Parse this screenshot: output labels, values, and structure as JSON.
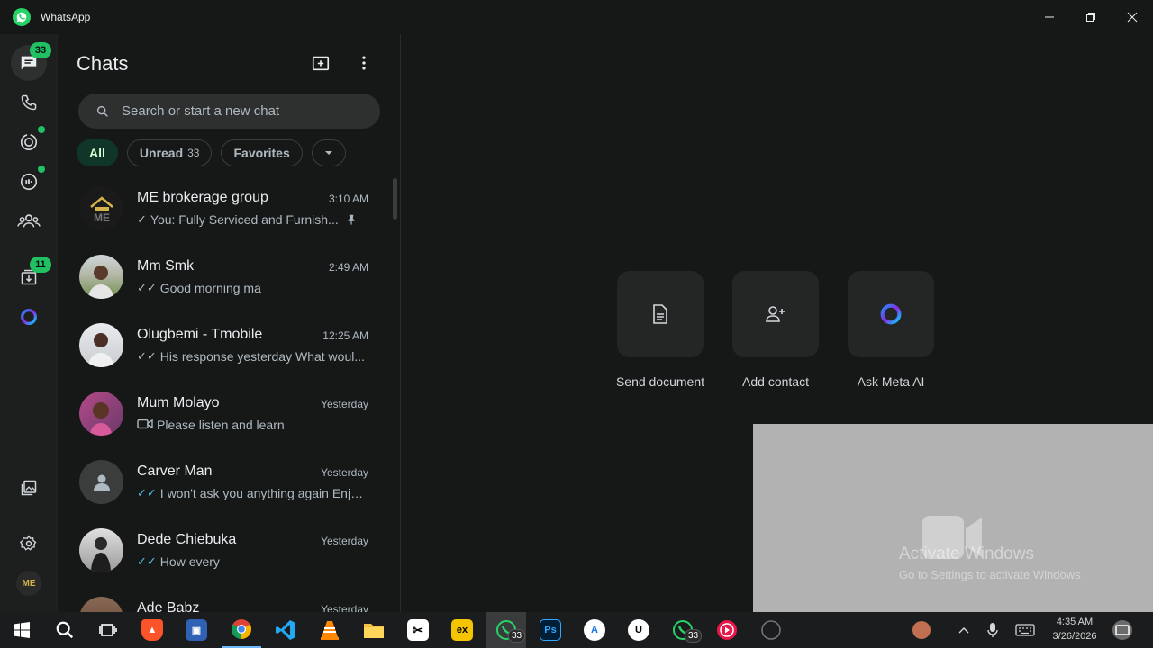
{
  "window": {
    "title": "WhatsApp"
  },
  "rail": {
    "chats_badge": "33",
    "communities_badge": "11"
  },
  "panel": {
    "title": "Chats",
    "search_placeholder": "Search or start a new chat",
    "filters": [
      {
        "label": "All"
      },
      {
        "label": "Unread",
        "count": "33"
      },
      {
        "label": "Favorites"
      }
    ]
  },
  "chats": [
    {
      "name": "ME brokerage group",
      "time": "3:10 AM",
      "tick": "✓",
      "tick_blue": false,
      "message": "You: Fully Serviced  and Furnish...",
      "pinned": true,
      "avatar_text": "ME",
      "avatar_color": "#1a1a1a"
    },
    {
      "name": "Mm Smk",
      "time": "2:49 AM",
      "tick": "✓✓",
      "tick_blue": false,
      "message": "Good morning ma",
      "avatar_text": "",
      "avatar_color": "#7e9a6a"
    },
    {
      "name": "Olugbemi - Tmobile",
      "time": "12:25 AM",
      "tick": "✓✓",
      "tick_blue": false,
      "message": "His response yesterday  What woul...",
      "avatar_text": "",
      "avatar_color": "#c9cdd0"
    },
    {
      "name": "Mum Molayo",
      "time": "Yesterday",
      "tick": "",
      "tick_blue": false,
      "message": "Please listen and learn",
      "video": true,
      "avatar_text": "",
      "avatar_color": "#8a4a7a"
    },
    {
      "name": "Carver Man",
      "time": "Yesterday",
      "tick": "✓✓",
      "tick_blue": true,
      "message": "I won't ask you anything again  Enjo...",
      "avatar_text": "",
      "avatar_color": "#3b3d3d"
    },
    {
      "name": "Dede Chiebuka",
      "time": "Yesterday",
      "tick": "✓✓",
      "tick_blue": true,
      "message": "How every",
      "avatar_text": "",
      "avatar_color": "#3a3a3a"
    },
    {
      "name": "Ade Babz",
      "time": "Yesterday",
      "tick": "",
      "tick_blue": false,
      "message": "",
      "avatar_text": "",
      "avatar_color": "#8a6a55"
    }
  ],
  "actions": [
    {
      "label": "Send document",
      "icon": "document-icon"
    },
    {
      "label": "Add contact",
      "icon": "add-contact-icon"
    },
    {
      "label": "Ask Meta AI",
      "icon": "meta-ai-icon"
    }
  ],
  "watermark": {
    "line1": "Activate Windows",
    "line2": "Go to Settings to activate Windows"
  },
  "taskbar": {
    "whatsapp_badge": "33",
    "whatsapp2_badge": "33",
    "time": "4:35 AM",
    "date": "3/26/2026"
  },
  "colors": {
    "accent": "#21c063",
    "background": "#161717",
    "active_chip": "#103529"
  }
}
